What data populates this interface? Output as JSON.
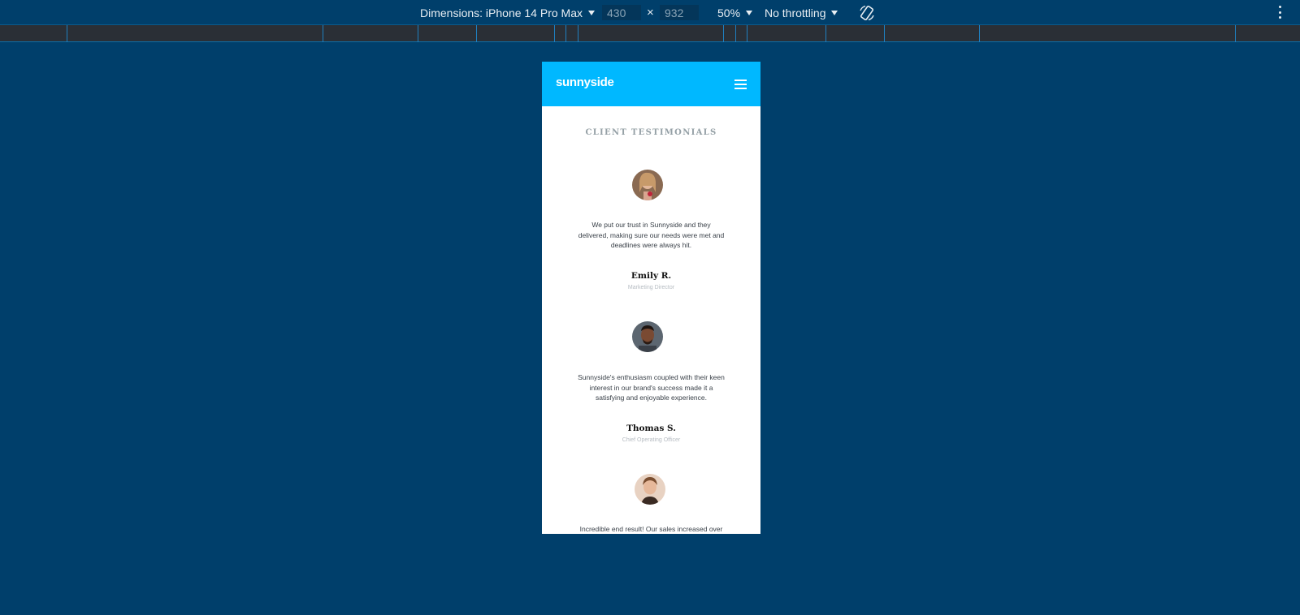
{
  "toolbar": {
    "dimensions_label": "Dimensions: iPhone 14 Pro Max",
    "width_value": "430",
    "times": "×",
    "height_value": "932",
    "zoom": "50%",
    "throttling": "No throttling",
    "rotate_icon": "rotate-icon",
    "more_icon": "more-vertical-icon"
  },
  "site": {
    "logo": "sunnyside",
    "menu_icon": "hamburger-menu-icon",
    "section_title": "CLIENT TESTIMONIALS",
    "testimonials": [
      {
        "quote": "We put our trust in Sunnyside and they delivered, making sure our needs were met and deadlines were always hit.",
        "name": "Emily R.",
        "role": "Marketing Director"
      },
      {
        "quote": "Sunnyside's enthusiasm coupled with their keen interest in our brand's success made it a satisfying and enjoyable experience.",
        "name": "Thomas S.",
        "role": "Chief Operating Officer"
      },
      {
        "quote": "Incredible end result! Our sales increased over",
        "name": "",
        "role": ""
      }
    ]
  },
  "colors": {
    "devtools_bg": "#003f6b",
    "header_bg": "#00b8ff",
    "title_gray": "#95a0a6"
  }
}
